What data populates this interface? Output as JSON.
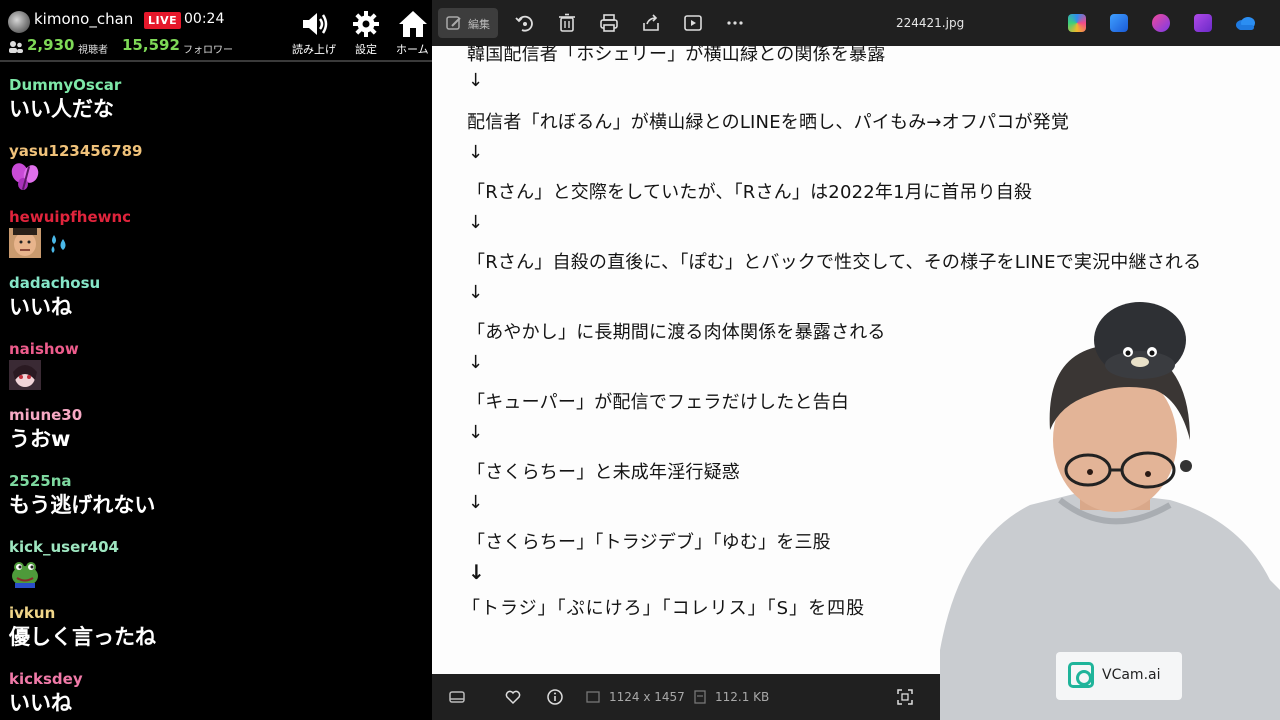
{
  "chat": {
    "streamer": "kimono_chan",
    "live_label": "LIVE",
    "elapsed": "00:24",
    "viewers": "2,930",
    "viewers_label": "視聴者",
    "followers": "15,592",
    "followers_label": "フォロワー",
    "buttons": {
      "read_aloud": "読み上げ",
      "settings": "設定",
      "home": "ホーム"
    },
    "messages": [
      {
        "user": "DummyOscar",
        "color": "#7ee8a8",
        "text": "いい人だな"
      },
      {
        "user": "yasu123456789",
        "color": "#f0c27a",
        "stamp": "butterfly-stamp"
      },
      {
        "user": "hewuipfhewnc",
        "color": "#e0243c",
        "stamp": "face-sweat-stamp"
      },
      {
        "user": "dadachosu",
        "color": "#86e6c8",
        "text": "いいね"
      },
      {
        "user": "naishow",
        "color": "#ee5c8c",
        "stamp": "character-stamp"
      },
      {
        "user": "miune30",
        "color": "#f6a9c4",
        "text": "うおw"
      },
      {
        "user": "2525na",
        "color": "#7ed9a0",
        "text": "もう逃げれない"
      },
      {
        "user": "kick_user404",
        "color": "#9ee6c0",
        "stamp": "frog-stamp"
      },
      {
        "user": "ivkun",
        "color": "#f0d68a",
        "text": "優しく言ったね"
      },
      {
        "user": "kicksdey",
        "color": "#f07aa8",
        "text": "いいね"
      }
    ]
  },
  "viewer": {
    "toolbar": {
      "edit_label": "編集",
      "file_name": "224421.jpg"
    },
    "document": {
      "lines": [
        "韓国配信者「ホシェリー」が横山緑との関係を暴露",
        "配信者「れぼるん」が横山緑とのLINEを晒し、パイもみ→オフパコが発覚",
        "「Rさん」と交際をしていたが、「Rさん」は2022年1月に首吊り自殺",
        "「Rさん」自殺の直後に、「ぽむ」とバックで性交して、その様子をLINEで実況中継される",
        "「あやかし」に長期間に渡る肉体関係を暴露される",
        "「キューパー」が配信でフェラだけしたと告白",
        "「さくらちー」と未成年淫行疑惑",
        "「さくらちー」「トラジデブ」「ゆむ」を三股",
        "「トラジ」「ぷにけろ」「コレリス」「S」を四股"
      ],
      "arrow": "↓"
    },
    "status": {
      "dimensions": "1124 x 1457",
      "size": "112.1 KB"
    },
    "webcam_overlay": {
      "brand": "VCam.ai"
    }
  }
}
